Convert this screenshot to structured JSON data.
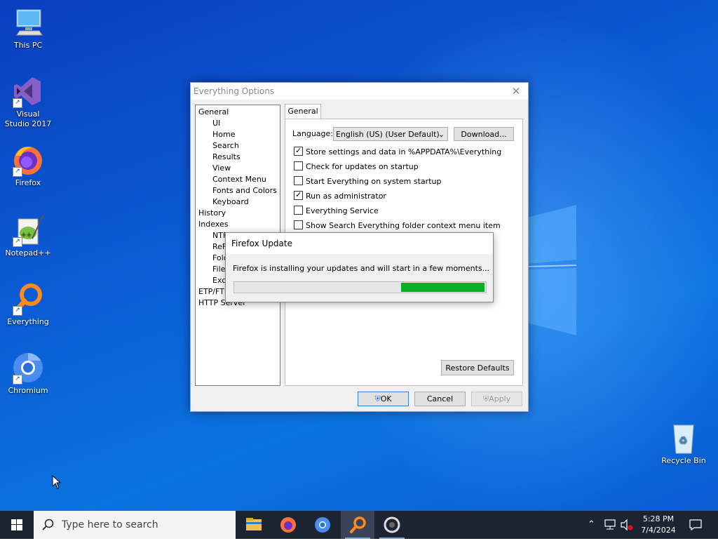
{
  "desktop": {
    "icons": [
      {
        "label": "This PC"
      },
      {
        "label": "Visual Studio 2017"
      },
      {
        "label": "Firefox"
      },
      {
        "label": "Notepad++"
      },
      {
        "label": "Everything"
      },
      {
        "label": "Chromium"
      },
      {
        "label": "Recycle Bin"
      }
    ]
  },
  "options_window": {
    "title": "Everything Options",
    "tree": [
      {
        "label": "General"
      },
      {
        "label": "UI"
      },
      {
        "label": "Home"
      },
      {
        "label": "Search"
      },
      {
        "label": "Results"
      },
      {
        "label": "View"
      },
      {
        "label": "Context Menu"
      },
      {
        "label": "Fonts and Colors"
      },
      {
        "label": "Keyboard"
      },
      {
        "label": "History"
      },
      {
        "label": "Indexes"
      },
      {
        "label": "NTFS"
      },
      {
        "label": "ReFS"
      },
      {
        "label": "Folders"
      },
      {
        "label": "File List"
      },
      {
        "label": "Exclude"
      },
      {
        "label": "ETP/FTP"
      },
      {
        "label": "HTTP Server"
      }
    ],
    "tab_label": "General",
    "language_label": "Language:",
    "language_value": "English (US) (User Default)",
    "download_label": "Download...",
    "checkboxes": [
      {
        "label": "Store settings and data in %APPDATA%\\Everything",
        "checked": true
      },
      {
        "label": "Check for updates on startup",
        "checked": false
      },
      {
        "label": "Start Everything on system startup",
        "checked": false
      },
      {
        "label": "Run as administrator",
        "checked": true
      },
      {
        "label": "Everything Service",
        "checked": false
      },
      {
        "label": "Show Search Everything folder context menu item",
        "checked": false
      }
    ],
    "restore_defaults_label": "Restore Defaults",
    "ok_label": "OK",
    "cancel_label": "Cancel",
    "apply_label": "Apply"
  },
  "firefox_dialog": {
    "title": "Firefox Update",
    "message": "Firefox is installing your updates and will start in a few moments...",
    "progress_state": "indeterminate"
  },
  "taskbar": {
    "search_placeholder": "Type here to search",
    "apps": [
      {
        "name": "file-explorer-icon"
      },
      {
        "name": "firefox-icon"
      },
      {
        "name": "chromium-icon"
      },
      {
        "name": "everything-icon",
        "active": true
      },
      {
        "name": "update-icon"
      }
    ],
    "time": "5:28 PM",
    "date": "7/4/2024"
  },
  "colors": {
    "desktop": "#0b5fd6",
    "taskbar": "#1c2431",
    "progress": "#06b025"
  }
}
